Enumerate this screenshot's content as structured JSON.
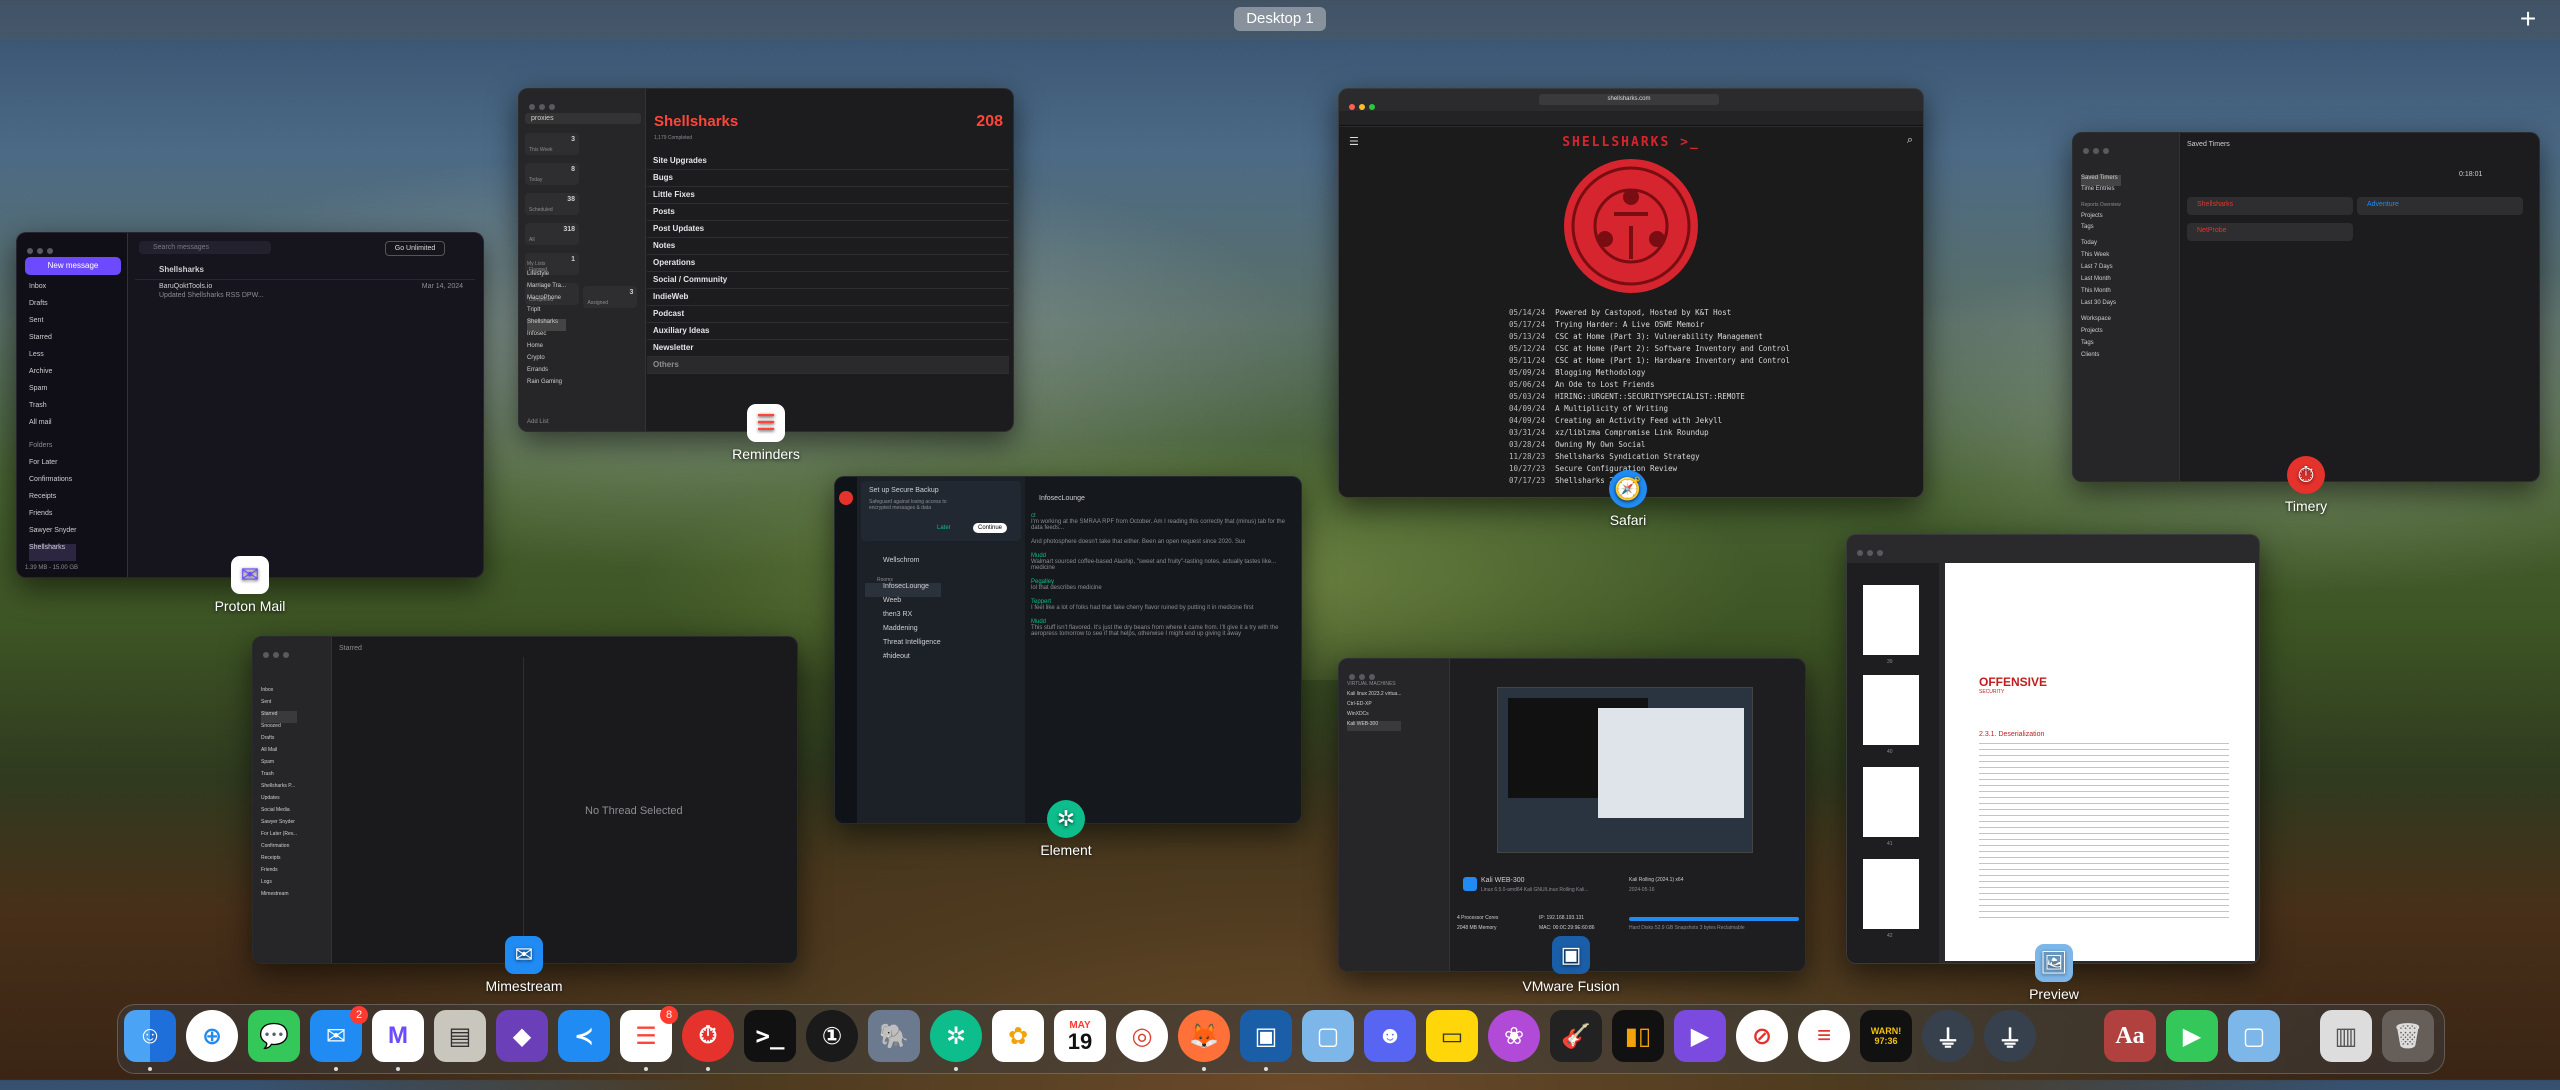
{
  "spaces": {
    "desktop_label": "Desktop 1",
    "add": "+"
  },
  "windows": {
    "proton": {
      "label": "Proton Mail",
      "search_placeholder": "Search messages",
      "new_message": "New message",
      "go_unlimited": "Go Unlimited",
      "folders": [
        "Inbox",
        "Drafts",
        "Sent",
        "Starred",
        "Less",
        "Archive",
        "Spam",
        "Trash",
        "All mail"
      ],
      "folders_header": "Folders",
      "custom_folders": [
        "For Later",
        "Confirmations",
        "Receipts",
        "Friends",
        "Sawyer Snyder",
        "Shellsharks"
      ],
      "current": "Shellsharks",
      "msg_sender": "BaruQoktTools.io",
      "msg_subject": "Updated Shellsharks RSS DPW...",
      "msg_date": "Mar 14, 2024",
      "footer_left": "1.39 MB - 15.00 GB",
      "footer_right": "5.1.40.4"
    },
    "reminders": {
      "label": "Reminders",
      "search": "proxies",
      "title": "Shellsharks",
      "count": "208",
      "completed": "1,179 Completed",
      "clear": "Clear",
      "show": "Show",
      "smart_lists": [
        {
          "name": "This Week",
          "count": "3"
        },
        {
          "name": "Today",
          "count": "8"
        },
        {
          "name": "Scheduled",
          "count": "38"
        },
        {
          "name": "All",
          "count": "318"
        },
        {
          "name": "Flagged",
          "count": "1"
        },
        {
          "name": "Completed",
          "count": ""
        },
        {
          "name": "Assigned",
          "count": "3"
        }
      ],
      "my_lists_header": "My Lists",
      "sidebar_lists": [
        "Lifestyle",
        "Marriage Tra...",
        "MacroPhone",
        "TripIt",
        "Shellsharks",
        "Infosec",
        "Home",
        "Crypto",
        "Errands",
        "Rain Gaming"
      ],
      "add_list": "Add List",
      "groups": [
        "Site Upgrades",
        "Bugs",
        "Little Fixes",
        "Posts",
        "Post Updates",
        "Notes",
        "Operations",
        "Social / Community",
        "IndieWeb",
        "Podcast",
        "Auxiliary Ideas",
        "Newsletter",
        "Others"
      ]
    },
    "safari": {
      "label": "Safari",
      "url": "shellsharks.com",
      "site_title": "SHELLSHARKS >_",
      "posts": [
        {
          "d": "05/14/24",
          "t": "Powered by Castopod, Hosted by K&T Host"
        },
        {
          "d": "05/17/24",
          "t": "Trying Harder: A Live OSWE Memoir"
        },
        {
          "d": "05/13/24",
          "t": "CSC at Home (Part 3): Vulnerability Management"
        },
        {
          "d": "05/12/24",
          "t": "CSC at Home (Part 2): Software Inventory and Control"
        },
        {
          "d": "05/11/24",
          "t": "CSC at Home (Part 1): Hardware Inventory and Control"
        },
        {
          "d": "05/09/24",
          "t": "Blogging Methodology"
        },
        {
          "d": "05/06/24",
          "t": "An Ode to Lost Friends"
        },
        {
          "d": "05/03/24",
          "t": "HIRING::URGENT::SECURITYSPECIALIST::REMOTE"
        },
        {
          "d": "04/09/24",
          "t": "A Multiplicity of Writing"
        },
        {
          "d": "04/09/24",
          "t": "Creating an Activity Feed with Jekyll"
        },
        {
          "d": "03/31/24",
          "t": "xz/liblzma Compromise Link Roundup"
        },
        {
          "d": "03/28/24",
          "t": "Owning My Own Social"
        },
        {
          "d": "11/28/23",
          "t": "Shellsharks Syndication Strategy"
        },
        {
          "d": "10/27/23",
          "t": "Secure Configuration Review"
        },
        {
          "d": "07/17/23",
          "t": "Shellsharks 2023"
        }
      ]
    },
    "timery": {
      "label": "Timery",
      "title": "Saved Timers",
      "time": "0:18:01",
      "sidebar": [
        "Saved Timers",
        "Time Entries",
        "Reports Overview",
        "Projects",
        "Tags",
        "Today",
        "This Week",
        "Last 7 Days",
        "Last Month",
        "This Month",
        "Last 30 Days",
        "Workspace",
        "Projects",
        "Tags",
        "Clients"
      ],
      "timers": [
        "Shellsharks",
        "Adventure",
        "NetProbe"
      ]
    },
    "mimestream": {
      "label": "Mimestream",
      "folder": "Starred",
      "empty": "No Thread Selected",
      "sidebar": [
        "Inbox",
        "Sent",
        "Starred",
        "Snoozed",
        "Drafts",
        "All Mail",
        "Spam",
        "Trash",
        "Shellsharks P...",
        "Updates",
        "Social Media",
        "Sawyer Snyder",
        "For Later (Rev...",
        "Confirmation",
        "Receipts",
        "Friends",
        "Logs",
        "Mimestream"
      ]
    },
    "element": {
      "label": "Element",
      "room": "InfosecLounge",
      "backup_title": "Set up Secure Backup",
      "backup_text": "Safeguard against losing access to encrypted messages & data",
      "later": "Later",
      "continue": "Continue",
      "rooms": [
        "Wellschrom",
        "InfosecLounge",
        "Weeb",
        "then3 RX",
        "Maddening",
        "Threat Intelligence",
        "#hideout"
      ],
      "rooms_header": "Rooms",
      "messages": [
        {
          "user": "ct",
          "text": "I'm working at the SMRAA RPF from October. Am I reading this correctly that (minus) tab for the data feeds..."
        },
        {
          "user": "",
          "text": "And photosphere doesn't take that either. Been an open request since 2020. Sux"
        },
        {
          "user": "Mudd",
          "text": "Walmart sourced coffee-based Alaship, \"sweet and fruity\"-tasting notes, actually tastes like... medicine"
        },
        {
          "user": "Pegalley",
          "text": "lol that describes medicine"
        },
        {
          "user": "Teppert",
          "text": "I feel like a lot of folks had that fake cherry flavor ruined by putting it in medicine first"
        },
        {
          "user": "Mudd",
          "text": "This stuff isn't flavored. It's just the dry beans from where it came from. I'll give it a try with the aeropress tomorrow to see if that helps, otherwise I might end up giving it away"
        }
      ]
    },
    "vmware": {
      "label": "VMware Fusion",
      "section": "VIRTUAL MACHINES",
      "vms": [
        "Kali linux 2023.2 virtua...",
        "Ctrl-ED-XP",
        "WinXDCs",
        "Kali WEB-300"
      ],
      "vm_name": "Kali WEB-300",
      "vm_os": "Linux 6.5.0-amd64 Kali GNU/Linux Rolling Kali...",
      "cores": "4 Processor Cores",
      "memory": "2048 MB Memory",
      "ip": "IP: 192.168.193.131",
      "mac": "MAC: 00:0C:29:9E:60:86",
      "disk_label": "Kali Rolling (2024.1) x64",
      "disk_date": "2024-05-16",
      "disk_stats": "Hard Disks 52.9 GB   Snapshots 3 bytes   Reclaimable"
    },
    "preview": {
      "label": "Preview",
      "doc_title": "OFFENSIVE",
      "doc_subtitle": "SECURITY",
      "section": "2.3.1. Deserialization",
      "pages": [
        "39",
        "40",
        "41",
        "42"
      ]
    }
  },
  "dock": {
    "badges": {
      "mail": "2",
      "reminders": "8"
    },
    "calendar_month": "MAY",
    "calendar_day": "19",
    "items": [
      "finder-icon",
      "safari-icon",
      "messages-icon",
      "mail-icon",
      "proton-mail-icon",
      "notes-stack-icon",
      "obsidian-icon",
      "vscode-icon",
      "timery-icon",
      "terminal-icon",
      "1password-icon",
      "tableplus-icon",
      "element-icon",
      "photos-icon",
      "calendar-icon",
      "chrome-icon",
      "firefox-icon",
      "vmware-icon",
      "preview-icon",
      "discord-icon",
      "notes-icon",
      "bloom-icon",
      "garageband-icon",
      "audio-icon",
      "iina-icon",
      "pocket-icon",
      "fantastical-icon",
      "warp-icon",
      "usb-icon",
      "ipsecure-icon",
      "dictionary-icon",
      "facetime-icon",
      "preview2-icon",
      "archive-icon",
      "trash-icon"
    ],
    "warp_label": "WARN!",
    "warp_time": "97:36",
    "dictionary_label": "Aa"
  },
  "colors": {
    "reminders_red": "#ff453a",
    "proton_purple": "#6d4aff",
    "element_green": "#0dbd8b",
    "timery_red": "#e5322c",
    "safari_blue": "#1f8bf3"
  }
}
